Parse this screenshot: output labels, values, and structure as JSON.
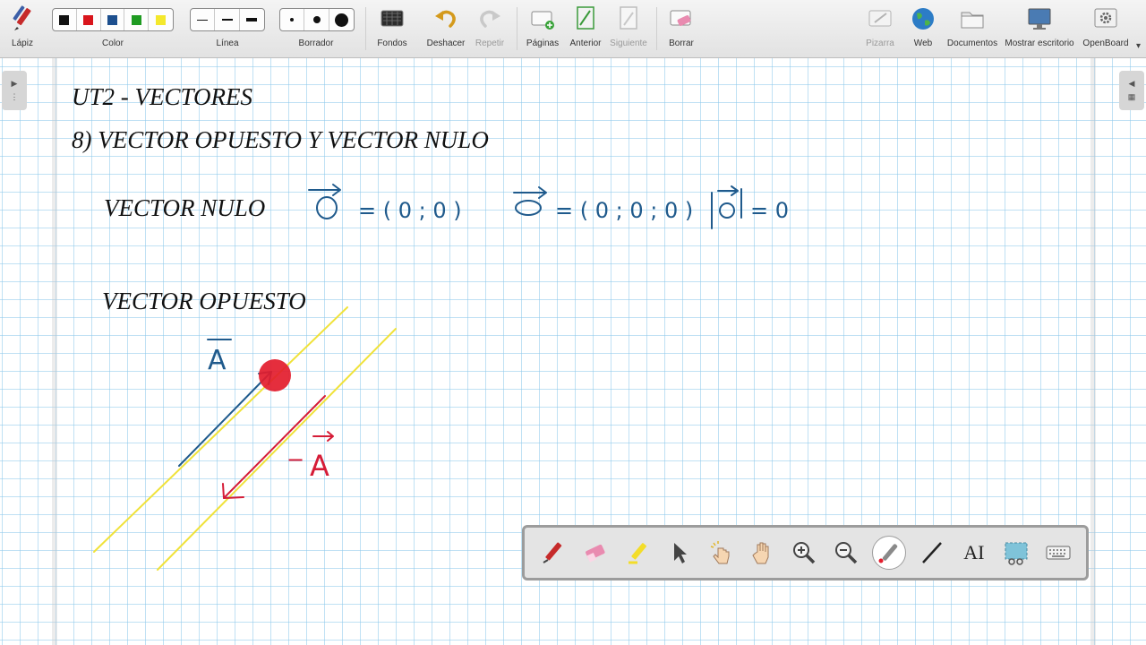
{
  "toolbar": {
    "pen_label": "Lápiz",
    "color_label": "Color",
    "colors": [
      "#111111",
      "#d8141b",
      "#1d4f8e",
      "#1f9b22",
      "#f4e82c"
    ],
    "line_label": "Línea",
    "eraser_label": "Borrador",
    "backgrounds_label": "Fondos",
    "undo_label": "Deshacer",
    "redo_label": "Repetir",
    "pages_label": "Páginas",
    "previous_label": "Anterior",
    "next_label": "Siguiente",
    "clear_label": "Borrar",
    "board_label": "Pizarra",
    "web_label": "Web",
    "documents_label": "Documentos",
    "desktop_label": "Mostrar escritorio",
    "app_label": "OpenBoard"
  },
  "board": {
    "title": "UT2 - VECTORES",
    "subtitle": "8) VECTOR OPUESTO Y VECTOR NULO",
    "null_vector_heading": "VECTOR NULO",
    "opposite_vector_heading": "VECTOR OPUESTO",
    "handwriting": {
      "null_2d": "= ( 0 ; 0 )",
      "null_3d": "= ( 0 ; 0 ; 0 )",
      "null_magnitude": "= 0",
      "vector_a": "A",
      "vector_minus_a": "A",
      "minus_sign": "−",
      "zero": "0"
    },
    "ink_colors": {
      "blue": "#1f5a8c",
      "red": "#d51c37",
      "yellow": "#f0e23a",
      "pointer": "#e31c2c"
    }
  },
  "floating_toolbar": {
    "tools": [
      "pen-icon",
      "eraser-icon",
      "highlighter-icon",
      "pointer-icon",
      "interact-icon",
      "hand-icon",
      "zoom-in-icon",
      "zoom-out-icon",
      "laser-pointer-icon",
      "line-icon",
      "text-icon",
      "capture-icon",
      "keyboard-icon"
    ],
    "text_tool_glyph": "AI"
  }
}
